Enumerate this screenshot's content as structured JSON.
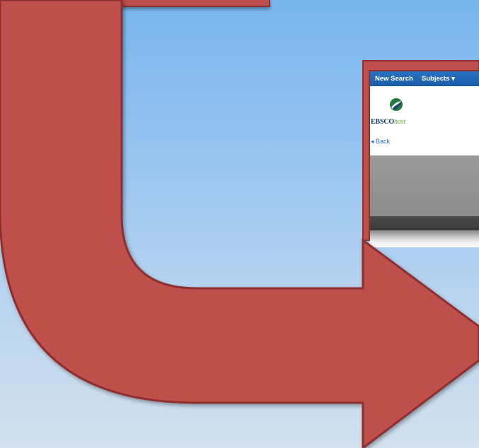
{
  "screenshot": {
    "nav": {
      "new_search": "New Search",
      "subjects": "Subjects ▾"
    },
    "logo": {
      "brand": "EBSCO",
      "suffix": "host"
    },
    "back_link": "◂ Back"
  },
  "colors": {
    "arrow": "#bf4f4c",
    "arrow_border": "#8e2f2d",
    "nav_blue": "#1a5ba8"
  }
}
